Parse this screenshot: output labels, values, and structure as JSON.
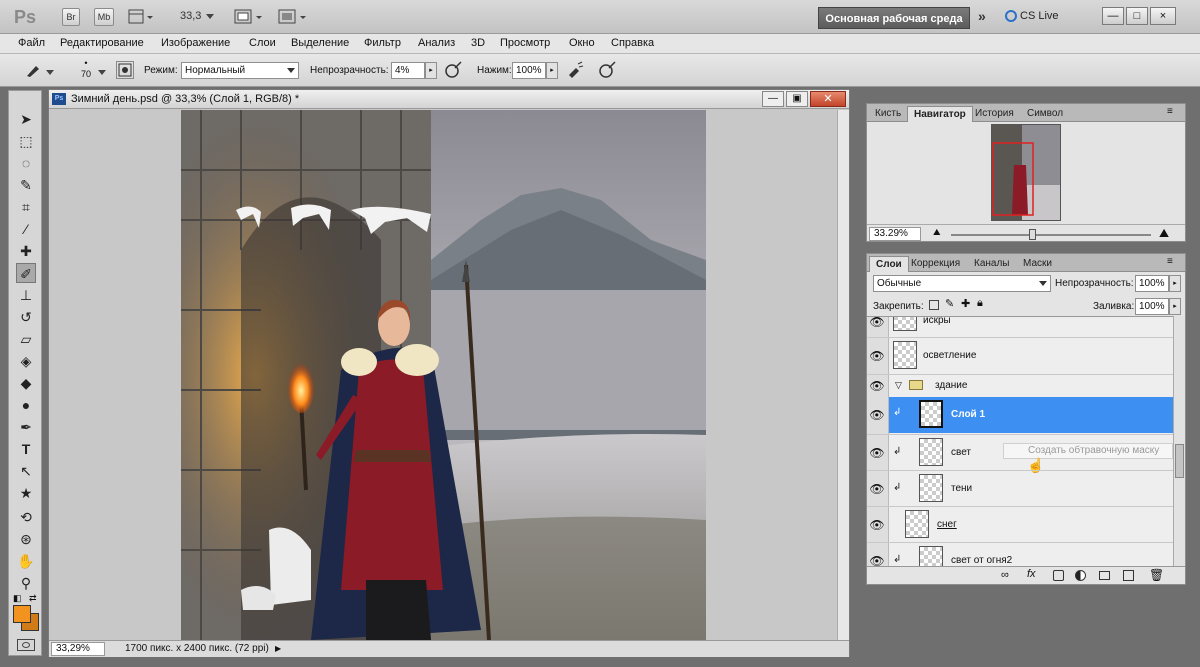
{
  "appbar": {
    "logo": "Ps",
    "bridge_label": "Br",
    "minibridge_label": "Mb",
    "zoom": "33,3",
    "workspace_label": "Основная рабочая среда",
    "extend_label": "»",
    "cslive_label": "CS Live",
    "win_min": "—",
    "win_max": "□",
    "win_close": "×"
  },
  "menu": [
    "Файл",
    "Редактирование",
    "Изображение",
    "Слои",
    "Выделение",
    "Фильтр",
    "Анализ",
    "3D",
    "Просмотр",
    "Окно",
    "Справка"
  ],
  "options": {
    "brush_size": "70",
    "mode_label": "Режим:",
    "mode_value": "Нормальный",
    "opacity_label": "Непрозрачность:",
    "opacity_value": "4%",
    "flow_label": "Нажим:",
    "flow_value": "100%"
  },
  "document": {
    "title": "Зимний день.psd @ 33,3% (Слой 1, RGB/8) *",
    "status_zoom": "33,29%",
    "status_info": "1700 пикс. x 2400 пикс. (72 ppi)"
  },
  "navigator": {
    "tabs": [
      "Кисть",
      "Навигатор",
      "История",
      "Символ"
    ],
    "active_tab": 1,
    "zoom": "33.29%"
  },
  "layers_panel": {
    "tabs": [
      "Слои",
      "Коррекция",
      "Каналы",
      "Маски"
    ],
    "active_tab": 0,
    "blend_mode": "Обычные",
    "opacity_label": "Непрозрачность:",
    "opacity_value": "100%",
    "lock_label": "Закрепить:",
    "fill_label": "Заливка:",
    "fill_value": "100%",
    "tooltip": "Создать обтравочную маску",
    "layers": [
      {
        "name": "искры",
        "clipped": false,
        "group": false,
        "selected": false
      },
      {
        "name": "осветление",
        "clipped": false,
        "group": false,
        "selected": false
      },
      {
        "name": "здание",
        "clipped": false,
        "group": true,
        "selected": false
      },
      {
        "name": "Слой 1",
        "clipped": true,
        "group": false,
        "selected": true
      },
      {
        "name": "свет",
        "clipped": true,
        "group": false,
        "selected": false
      },
      {
        "name": "тени",
        "clipped": true,
        "group": false,
        "selected": false
      },
      {
        "name": "снег",
        "clipped": false,
        "group": false,
        "selected": false
      },
      {
        "name": "свет от огня2",
        "clipped": true,
        "group": false,
        "selected": false
      }
    ]
  },
  "colors": {
    "foreground": "#f2921f",
    "background": "#d07a18",
    "selection": "#3d8ff2"
  }
}
